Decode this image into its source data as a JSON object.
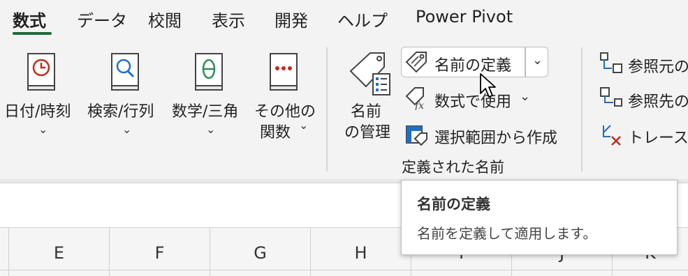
{
  "tabs": [
    {
      "label": "数式",
      "active": true
    },
    {
      "label": "データ"
    },
    {
      "label": "校閲"
    },
    {
      "label": "表示"
    },
    {
      "label": "開発"
    },
    {
      "label": "ヘルプ"
    },
    {
      "label": "Power Pivot"
    }
  ],
  "function_library": {
    "datetime": {
      "label": "日付/時刻",
      "icon": "clock-icon"
    },
    "lookup": {
      "label": "検索/行列",
      "icon": "search-icon"
    },
    "mathtrig": {
      "label": "数学/三角",
      "icon": "theta-icon",
      "symbol": "θ"
    },
    "more": {
      "label1": "その他の",
      "label2": "関数",
      "icon": "dots-icon"
    }
  },
  "defined_names": {
    "name_manager": {
      "line1": "名前",
      "line2": "の管理"
    },
    "define_name": "名前の定義",
    "use_in_formula": "数式で使用",
    "create_from_selection": "選択範囲から作成",
    "group_label": "定義された名前"
  },
  "formula_auditing": {
    "trace_precedents": "参照元の",
    "trace_dependents": "参照先の",
    "remove_arrows": "トレース矢"
  },
  "columns": [
    "E",
    "F",
    "G",
    "H",
    "I",
    "J",
    "K"
  ],
  "tooltip": {
    "title": "名前の定義",
    "description": "名前を定義して適用します。"
  },
  "colors": {
    "accent_green": "#1e6b3a",
    "icon_red": "#c42b1c",
    "icon_blue": "#1f6fc2",
    "icon_green": "#2e8b57"
  }
}
